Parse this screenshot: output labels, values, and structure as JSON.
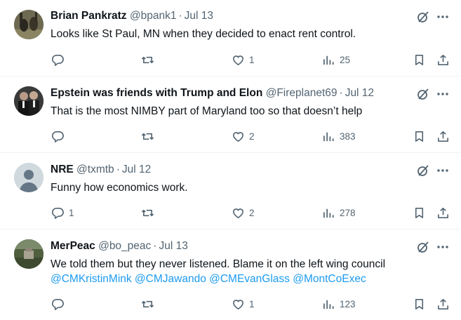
{
  "tweets": [
    {
      "name": "Brian Pankratz",
      "handle": "@bpank1",
      "dot": "·",
      "date": "Jul 13",
      "text": "Looks like St Paul, MN when they decided to enact rent control.",
      "mentions": "",
      "replies": "",
      "likes": "1",
      "views": "25",
      "avatar_color": "#5a5a48"
    },
    {
      "name": "Epstein was friends with Trump and Elon",
      "handle": "@Fireplanet69",
      "dot": "·",
      "date": "Jul 12",
      "text": "That is the most NIMBY part of Maryland too so that doesn’t help",
      "mentions": "",
      "replies": "",
      "likes": "2",
      "views": "383",
      "avatar_color": "#2b2b2b"
    },
    {
      "name": "NRE",
      "handle": "@txmtb",
      "dot": "·",
      "date": "Jul 12",
      "text": "Funny how economics work.",
      "mentions": "",
      "replies": "1",
      "likes": "2",
      "views": "278",
      "avatar_color": "#cfd9de"
    },
    {
      "name": "MerPeac",
      "handle": "@bo_peac",
      "dot": "·",
      "date": "Jul 13",
      "text": "We told them but they never listened. Blame it on the left wing council",
      "mentions": "@CMKristinMink @CMJawando @CMEvanGlass @MontCoExec",
      "replies": "",
      "likes": "1",
      "views": "123",
      "avatar_color": "#6b7a5a"
    }
  ],
  "icons": [
    "reply-icon",
    "retweet-icon",
    "like-icon",
    "views-icon",
    "bookmark-icon",
    "share-icon",
    "grok-icon",
    "more-icon"
  ],
  "colors": {
    "text": "#0f1419",
    "secondary": "#536471",
    "mention": "#1d9bf0",
    "divider": "#eff3f4"
  }
}
